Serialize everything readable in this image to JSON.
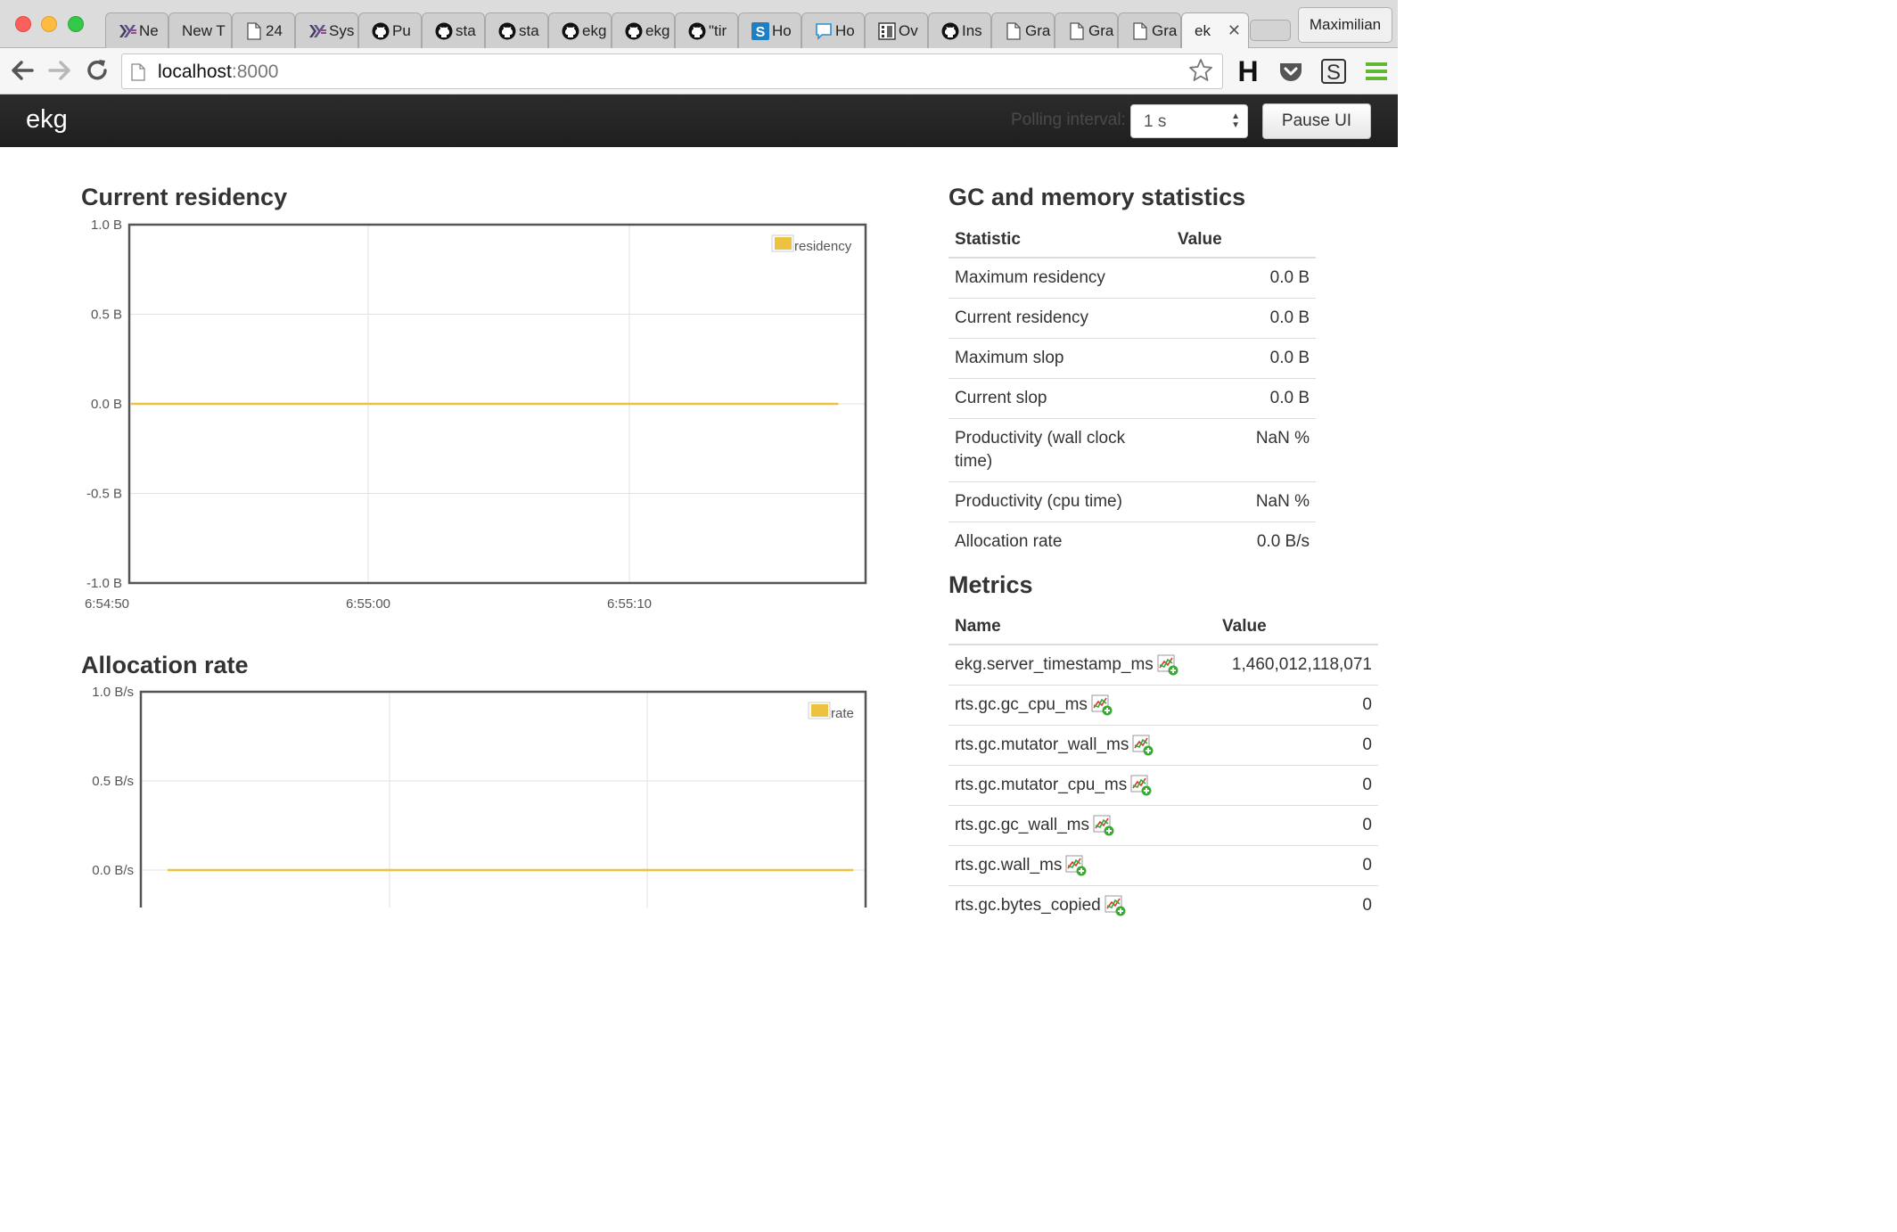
{
  "browser": {
    "tabs": [
      {
        "label": "Ne",
        "icon": "haskell-icon"
      },
      {
        "label": "New T",
        "icon": ""
      },
      {
        "label": "24",
        "icon": "document-icon"
      },
      {
        "label": "Sys",
        "icon": "haskell-icon"
      },
      {
        "label": "Pu",
        "icon": "github-icon"
      },
      {
        "label": "sta",
        "icon": "github-icon"
      },
      {
        "label": "sta",
        "icon": "github-icon"
      },
      {
        "label": "ekg",
        "icon": "github-icon"
      },
      {
        "label": "ekg",
        "icon": "github-icon"
      },
      {
        "label": "\"tir",
        "icon": "github-icon"
      },
      {
        "label": "Ho",
        "icon": "s-logo-icon"
      },
      {
        "label": "Ho",
        "icon": "chat-bubble-icon"
      },
      {
        "label": "Ov",
        "icon": "building-icon"
      },
      {
        "label": "Ins",
        "icon": "github-icon"
      },
      {
        "label": "Gra",
        "icon": "document-icon"
      },
      {
        "label": "Gra",
        "icon": "document-icon"
      },
      {
        "label": "Gra",
        "icon": "document-icon"
      },
      {
        "label": "ek",
        "icon": "",
        "active": true
      }
    ],
    "profile_name": "Maximilian",
    "url_host": "localhost",
    "url_port": ":8000",
    "extension_h_label": "H"
  },
  "app": {
    "brand": "ekg",
    "polling_label": "Polling interval:",
    "polling_value": "1 s",
    "pause_label": "Pause UI"
  },
  "charts": {
    "residency": {
      "title": "Current residency",
      "legend": "residency",
      "color": "#edc240"
    },
    "allocation": {
      "title": "Allocation rate",
      "legend": "rate",
      "color": "#edc240"
    }
  },
  "chart_data": [
    {
      "type": "line",
      "title": "Current residency",
      "xlabel": "",
      "ylabel": "",
      "x_ticks": [
        "6:54:50",
        "6:55:00",
        "6:55:10"
      ],
      "y_ticks": [
        "1.0 B",
        "0.5 B",
        "0.0 B",
        "-0.5 B",
        "-1.0 B"
      ],
      "ylim": [
        -1.0,
        1.0
      ],
      "grid": true,
      "legend_position": "top-right",
      "series": [
        {
          "name": "residency",
          "x": [
            "6:54:50",
            "6:55:00",
            "6:55:10",
            "6:55:18"
          ],
          "values": [
            0,
            0,
            0,
            0
          ]
        }
      ]
    },
    {
      "type": "line",
      "title": "Allocation rate",
      "xlabel": "",
      "ylabel": "",
      "y_ticks": [
        "1.0 B/s",
        "0.5 B/s",
        "0.0 B/s"
      ],
      "ylim": [
        -1.0,
        1.0
      ],
      "grid": true,
      "legend_position": "top-right",
      "series": [
        {
          "name": "rate",
          "x": [
            "6:54:50",
            "6:55:00",
            "6:55:10",
            "6:55:18"
          ],
          "values": [
            0,
            0,
            0,
            0
          ]
        }
      ]
    }
  ],
  "gc_stats": {
    "title": "GC and memory statistics",
    "col_statistic": "Statistic",
    "col_value": "Value",
    "rows": [
      {
        "name": "Maximum residency",
        "value": "0.0 B"
      },
      {
        "name": "Current residency",
        "value": "0.0 B"
      },
      {
        "name": "Maximum slop",
        "value": "0.0 B"
      },
      {
        "name": "Current slop",
        "value": "0.0 B"
      },
      {
        "name": "Productivity (wall clock time)",
        "value": "NaN %"
      },
      {
        "name": "Productivity (cpu time)",
        "value": "NaN %"
      },
      {
        "name": "Allocation rate",
        "value": "0.0 B/s"
      }
    ]
  },
  "metrics": {
    "title": "Metrics",
    "col_name": "Name",
    "col_value": "Value",
    "rows": [
      {
        "name": "ekg.server_timestamp_ms",
        "value": "1,460,012,118,071"
      },
      {
        "name": "rts.gc.gc_cpu_ms",
        "value": "0"
      },
      {
        "name": "rts.gc.mutator_wall_ms",
        "value": "0"
      },
      {
        "name": "rts.gc.mutator_cpu_ms",
        "value": "0"
      },
      {
        "name": "rts.gc.gc_wall_ms",
        "value": "0"
      },
      {
        "name": "rts.gc.wall_ms",
        "value": "0"
      },
      {
        "name": "rts.gc.bytes_copied",
        "value": "0"
      }
    ]
  }
}
